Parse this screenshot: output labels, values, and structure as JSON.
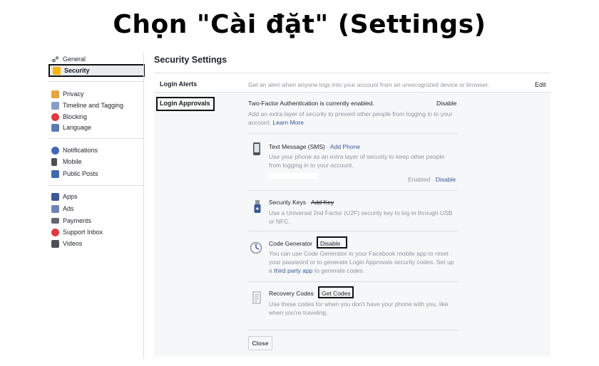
{
  "caption": "Chọn \"Cài đặt\" (Settings)",
  "sidebar": {
    "items": [
      {
        "label": "General",
        "icon": "gears-icon"
      },
      {
        "label": "Security",
        "icon": "shield-badge-icon"
      },
      {
        "label": "Privacy",
        "icon": "privacy-lock-icon"
      },
      {
        "label": "Timeline and Tagging",
        "icon": "timeline-icon"
      },
      {
        "label": "Blocking",
        "icon": "blocking-icon"
      },
      {
        "label": "Language",
        "icon": "language-icon"
      },
      {
        "label": "Notifications",
        "icon": "globe-icon"
      },
      {
        "label": "Mobile",
        "icon": "phone-icon"
      },
      {
        "label": "Public Posts",
        "icon": "rss-icon"
      },
      {
        "label": "Apps",
        "icon": "apps-icon"
      },
      {
        "label": "Ads",
        "icon": "ads-icon"
      },
      {
        "label": "Payments",
        "icon": "card-icon"
      },
      {
        "label": "Support Inbox",
        "icon": "lifebuoy-icon"
      },
      {
        "label": "Videos",
        "icon": "film-icon"
      }
    ]
  },
  "main": {
    "title": "Security Settings",
    "login_alerts": {
      "label": "Login Alerts",
      "desc": "Get an alert when anyone logs into your account from an unrecognized device or browser.",
      "edit": "Edit"
    },
    "login_approvals": {
      "label": "Login Approvals",
      "status": "Two-Factor Authentication is currently enabled.",
      "disable": "Disable",
      "desc": "Add an extra layer of security to prevent other people from logging in to your account.",
      "learn_more": "Learn More",
      "methods": {
        "sms": {
          "title": "Text Message (SMS)",
          "sep": " · ",
          "action": "Add Phone",
          "desc": "Use your phone as an extra layer of security to keep other people from logging in to your account.",
          "enabled": "Enabled",
          "disable": "Disable"
        },
        "keys": {
          "title": "Security Keys",
          "sep": " · ",
          "action": "Add Key",
          "desc": "Use a Universal 2nd Factor (U2F) security key to log in through USB or NFC."
        },
        "generator": {
          "title": "Code Generator",
          "action": "Disable",
          "desc_a": "You can use Code Generator in your Facebook mobile app to reset your password or to generate Login Approvals security codes. Set up a",
          "link": "third party app",
          "desc_b": "to generate codes"
        },
        "recovery": {
          "title": "Recovery Codes",
          "action": "Get Codes",
          "desc": "Use these codes for when you don't have your phone with you, like when you're traveling."
        }
      },
      "close": "Close"
    }
  }
}
